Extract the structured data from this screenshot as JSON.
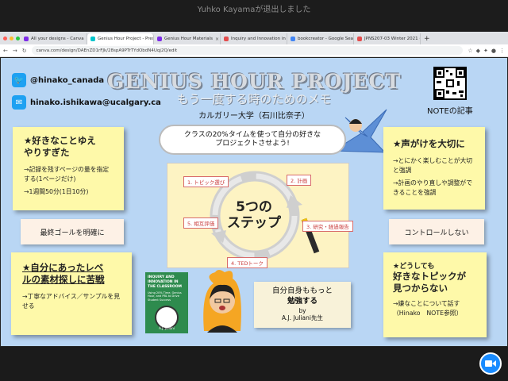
{
  "window": {
    "notice": "Yuhko Kayamaが退出しました"
  },
  "tabs": [
    {
      "label": "All your designs - Canva",
      "color": "#7d2ae8",
      "active": false
    },
    {
      "label": "Genius Hour Project - Present",
      "color": "#00c4cc",
      "active": true
    },
    {
      "label": "Genius Hour Materials",
      "color": "#7d2ae8",
      "active": false
    },
    {
      "label": "Inquiry and Innovation in the C",
      "color": "#e44d4d",
      "active": false
    },
    {
      "label": "bookcreator - Google Search",
      "color": "#4285f4",
      "active": false
    },
    {
      "label": "JPNS207-03 Winter 2021 (Ko",
      "color": "#e44d4d",
      "active": false
    }
  ],
  "address_bar": {
    "url": "canva.com/design/DAEnZD1rFJk/28spA9PTrTYdObdN4Uqj2Q/edit"
  },
  "poster": {
    "twitter": "@hinako_canada",
    "email": "hinako.ishikawa@ucalgary.ca",
    "title": "GENIUS HOUR PROJECT",
    "subtitle": "もう一度する時のためのメモ",
    "university": "カルガリー大学（石川比奈子）",
    "note_label": "NOTEの記事",
    "bubble": "クラスの20%タイムを使って自分の好きな\nプロジェクトさせよう!",
    "center": "5つの\nステップ",
    "steps": [
      "1. トピック選び",
      "2. 計画",
      "3. 研究・経過報告",
      "4. TEDトーク",
      "5. 相互評価"
    ],
    "note1": {
      "title1": "★好きなことゆえ",
      "title2": "やりすぎた",
      "p1": "→記録を残すページの量を指定する(1ページだけ)",
      "p2": "→1週間50分(1日10分)"
    },
    "note2": {
      "title1": "★声がけを大切に",
      "p1": "→とにかく楽しむことが大切と強調",
      "p2": "→計画のやり直しや調整ができることを強調"
    },
    "label_left": "最終ゴールを明確に",
    "label_right": "コントロールしない",
    "note3": {
      "title1": "★自分にあったレベ",
      "title2": "ルの素材探しに苦戦",
      "p1": "→丁寧なアドバイス／サンプルを見せる"
    },
    "note4": {
      "pre": "★どうしても",
      "title1": "好きなトピックが",
      "title2": "見つからない",
      "p1": "→嫌なことについて話す（Hinako　NOTE参照）"
    },
    "book": {
      "title": "INQUIRY AND INNOVATION IN THE CLASSROOM",
      "sub": "Using 20% Time, Genius Hour, and PBL to Drive Student Success",
      "author": "A.J. Juliani"
    },
    "quote": {
      "line1": "自分自身ももっと",
      "line2": "勉強する",
      "by": "by",
      "name": "A.J. Juliani先生"
    }
  }
}
